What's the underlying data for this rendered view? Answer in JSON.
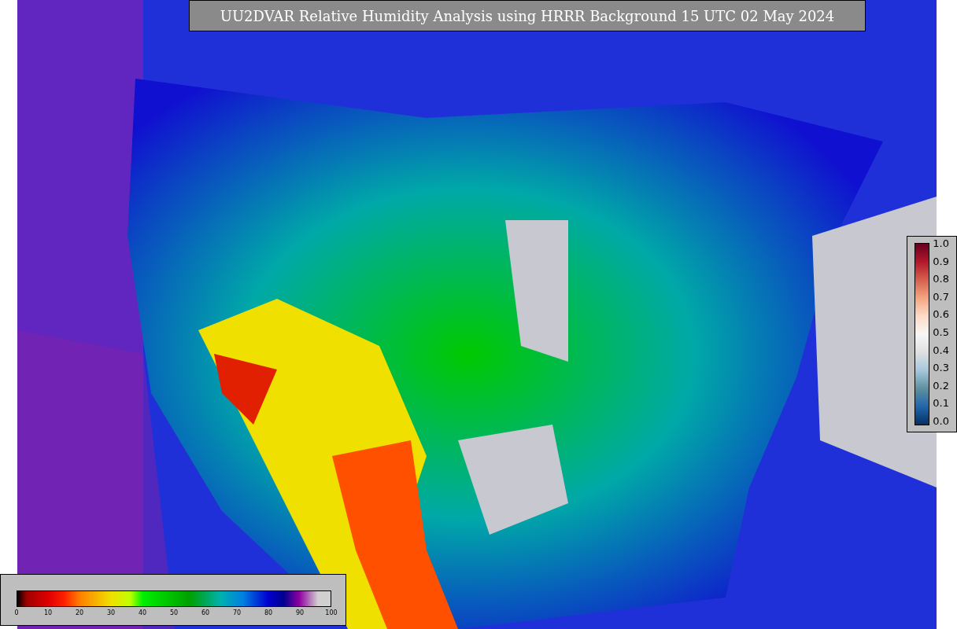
{
  "title": "UU2DVAR Relative Humidity Analysis using HRRR Background 15 UTC 02 May 2024",
  "station_colorbar": {
    "ticks": [
      "1.0",
      "0.9",
      "0.8",
      "0.7",
      "0.6",
      "0.5",
      "0.4",
      "0.3",
      "0.2",
      "0.1",
      "0.0"
    ]
  },
  "humidity_colorbar": {
    "ticks": [
      "0",
      "10",
      "20",
      "30",
      "40",
      "50",
      "60",
      "70",
      "80",
      "90",
      "100"
    ]
  }
}
